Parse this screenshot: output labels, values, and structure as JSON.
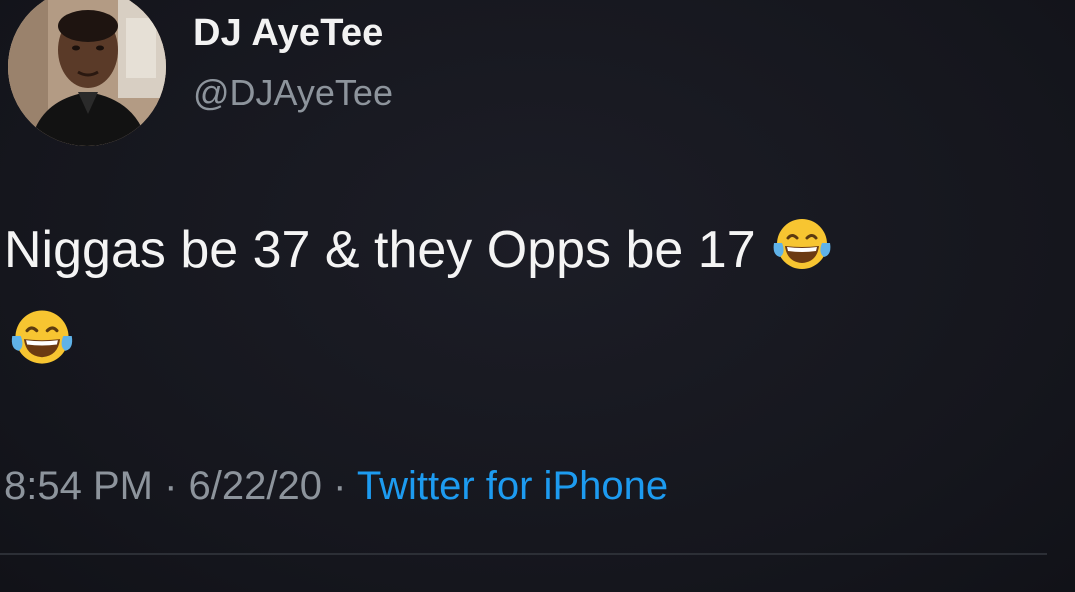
{
  "tweet": {
    "display_name": "DJ AyeTee",
    "handle": "@DJAyeTee",
    "text": "Niggas be 37 & they Opps be 17",
    "emoji": "face-with-tears-of-joy",
    "time": "8:54 PM",
    "separator": "·",
    "date": "6/22/20",
    "source": "Twitter for iPhone"
  },
  "colors": {
    "background": "#17181f",
    "name": "#f2f2f2",
    "text": "#f4f4f4",
    "muted": "#8d949c",
    "link": "#1d9bf0"
  },
  "icons": {
    "avatar": "profile-photo",
    "emoji": "face-with-tears-of-joy-icon"
  }
}
